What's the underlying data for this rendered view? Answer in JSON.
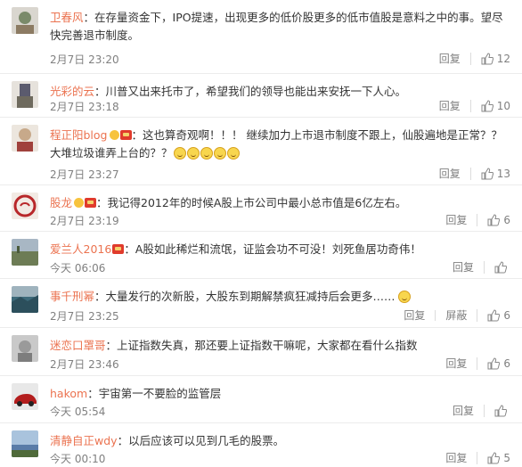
{
  "comments": [
    {
      "user": "卫春风",
      "body": "：在存量资金下，IPO提速，出现更多的低价股更多的低市值股是意料之中的事。望尽快完善退市制度。",
      "time": "2月7日 23:20",
      "reply": "回复",
      "likes": "12",
      "avatar_color": "#7a8a6a",
      "badges": [],
      "emojis": 0
    },
    {
      "user": "光彩的云",
      "body": "：川普又出来托市了，希望我们的领导也能出来安抚一下人心。",
      "time": "2月7日 23:18",
      "reply": "回复",
      "likes": "10",
      "avatar_color": "#5b5b6e",
      "badges": [],
      "emojis": 0
    },
    {
      "user": "程正阳blog",
      "body": "：这也算奇观啊！！！ 继续加力上市退市制度不跟上，仙股遍地是正常？？大堆垃圾谁弄上台的？？",
      "time": "2月7日 23:27",
      "reply": "回复",
      "likes": "13",
      "avatar_color": "#c7a98a",
      "badges": [
        "v",
        "m"
      ],
      "emojis": 5
    },
    {
      "user": "股龙",
      "body": "：我记得2012年的时候A股上市公司中最小总市值是6亿左右。",
      "time": "2月7日 23:19",
      "reply": "回复",
      "likes": "6",
      "avatar_color": "#b8272a",
      "badges": [
        "v",
        "m"
      ],
      "emojis": 0
    },
    {
      "user": "爱兰人2016",
      "body": "：A股如此稀烂和流氓，证监会功不可没！刘死鱼居功奇伟！",
      "time": "今天 06:06",
      "reply": "回复",
      "likes": "",
      "avatar_color": "#6d7c55",
      "badges": [
        "m"
      ],
      "emojis": 0
    },
    {
      "user": "事千刑幂",
      "body": "：大量发行的次新股，大股东到期解禁疯狂减持后会更多……",
      "time": "2月7日 23:25",
      "reply": "回复",
      "block": "屏蔽",
      "likes": "6",
      "avatar_color": "#3d6a7a",
      "badges": [],
      "emojis": 1
    },
    {
      "user": "迷恋口罩哥",
      "body": "：上证指数失真，那还要上证指数干嘛呢，大家都在看什么指数",
      "time": "2月7日 23:46",
      "reply": "回复",
      "likes": "6",
      "avatar_color": "#9a9a9a",
      "badges": [],
      "emojis": 0
    },
    {
      "user": "hakom",
      "body": "：宇宙第一不要脸的监管层",
      "time": "今天 05:54",
      "reply": "回复",
      "likes": "",
      "avatar_color": "#b31d1d",
      "badges": [],
      "emojis": 0
    },
    {
      "user": "清静自正wdy",
      "body": "：以后应该可以见到几毛的股票。",
      "time": "今天 00:10",
      "reply": "回复",
      "likes": "5",
      "avatar_color": "#5a7ca8",
      "badges": [],
      "emojis": 0
    }
  ]
}
